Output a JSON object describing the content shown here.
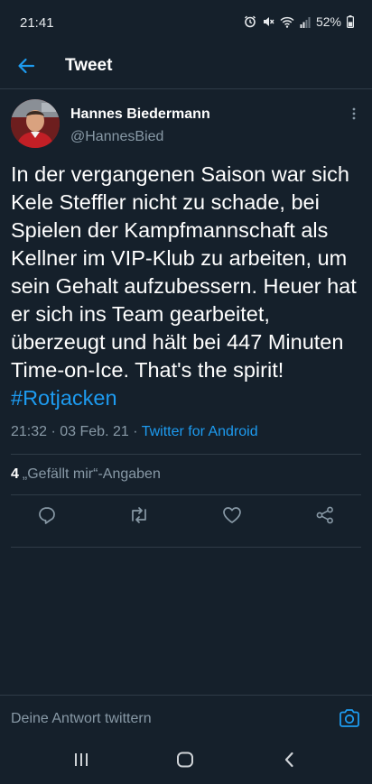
{
  "status_bar": {
    "time": "21:41",
    "battery": "52%"
  },
  "header": {
    "title": "Tweet"
  },
  "tweet": {
    "author_name": "Hannes Biedermann",
    "author_handle": "@HannesBied",
    "text_main": "In der vergangenen Saison war sich Kele Steffler nicht zu schade, bei Spielen der Kampfmannschaft als Kellner im VIP-Klub zu arbeiten, um sein Gehalt aufzubessern. Heuer hat er sich ins Team gearbeitet, überzeugt und hält bei 447 Minuten Time-on-Ice. That's the spirit! ",
    "hashtag": "#Rotjacken",
    "timestamp": "21:32 · 03 Feb. 21 · ",
    "client": "Twitter for Android",
    "likes_count": "4",
    "likes_label": "„Gefällt mir“-Angaben"
  },
  "reply": {
    "placeholder": "Deine Antwort twittern"
  },
  "colors": {
    "background": "#15202b",
    "accent": "#1d9bf0",
    "muted": "#8899a6",
    "divider": "#2f3b47"
  },
  "icons": [
    "alarm-icon",
    "mute-icon",
    "wifi-icon",
    "signal-icon",
    "battery-icon",
    "back-arrow-icon",
    "more-vertical-icon",
    "reply-icon",
    "retweet-icon",
    "like-icon",
    "share-icon",
    "camera-icon",
    "recent-apps-icon",
    "home-icon",
    "back-nav-icon"
  ]
}
